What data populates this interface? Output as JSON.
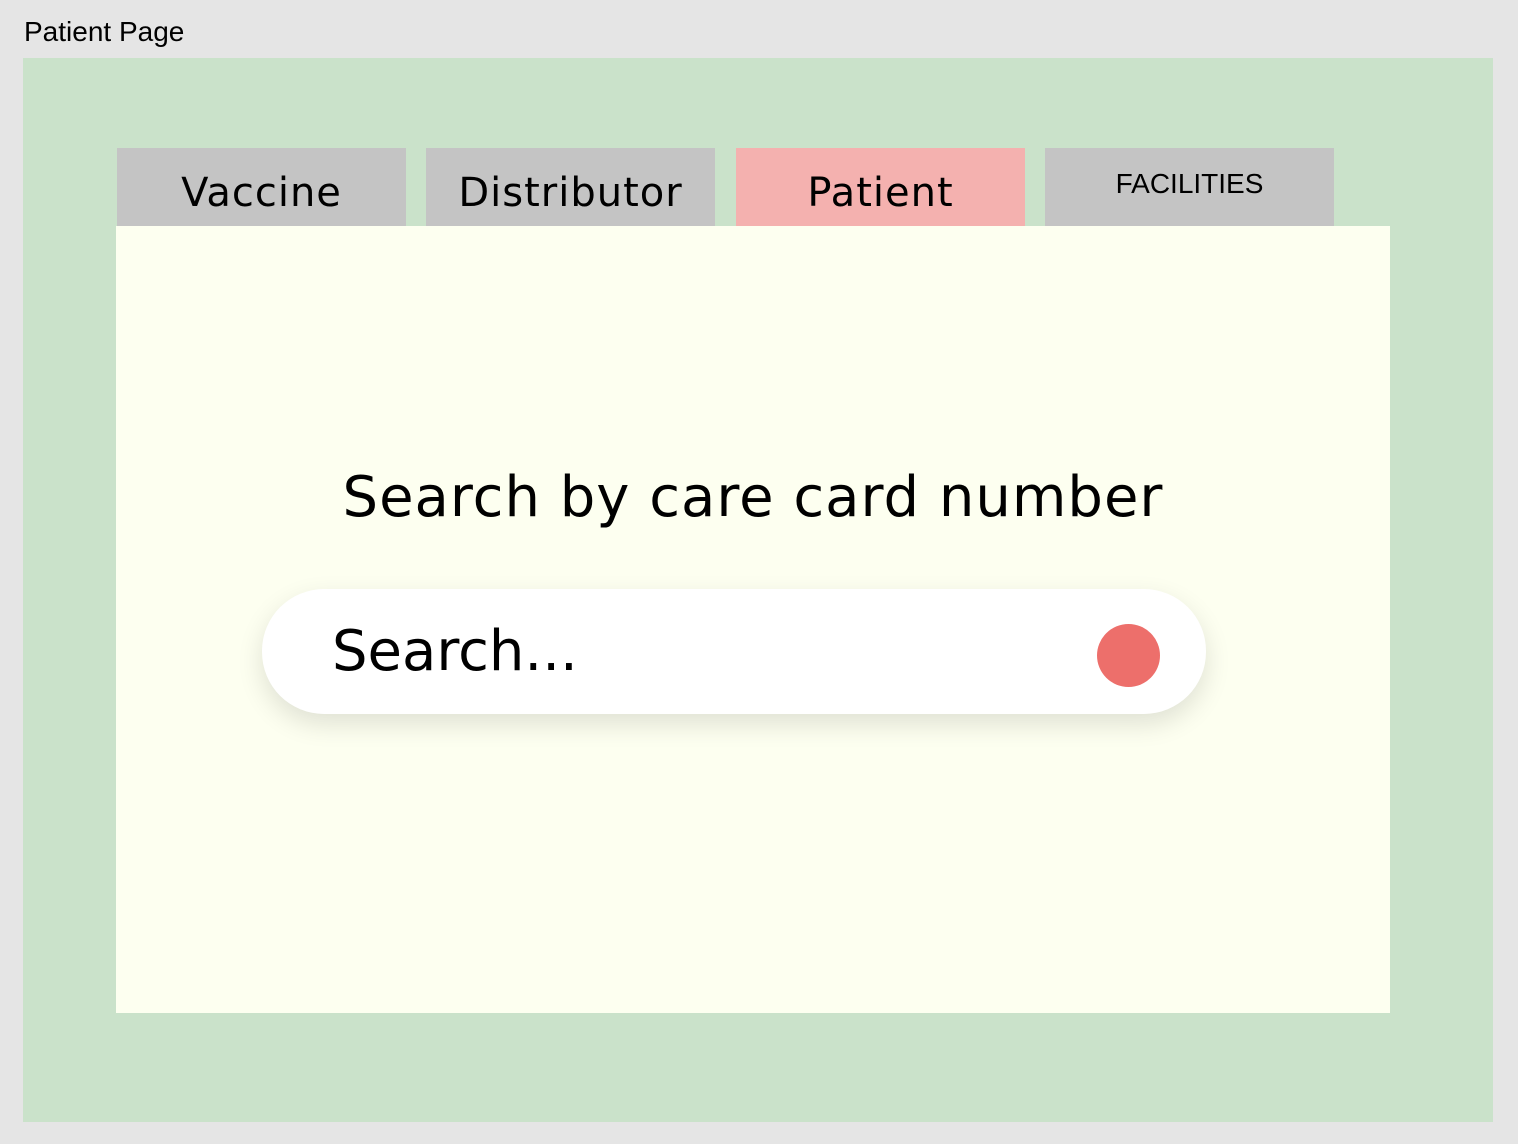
{
  "frame": {
    "title": "Patient Page"
  },
  "tabs": [
    {
      "label": "Vaccine",
      "active": false
    },
    {
      "label": "Distributor",
      "active": false
    },
    {
      "label": "Patient",
      "active": true
    },
    {
      "label": "FACILITIES",
      "active": false
    }
  ],
  "main": {
    "heading": "Search by care card number",
    "search": {
      "placeholder": "Search...",
      "value": "",
      "button_icon": "search-dot-icon",
      "button_color": "#ed6f6b"
    }
  },
  "colors": {
    "page_background": "#e5e5e5",
    "frame_background": "#cae2ca",
    "panel_background": "#fdfff0",
    "tab_inactive": "#c4c4c4",
    "tab_active": "#f4b1af"
  }
}
